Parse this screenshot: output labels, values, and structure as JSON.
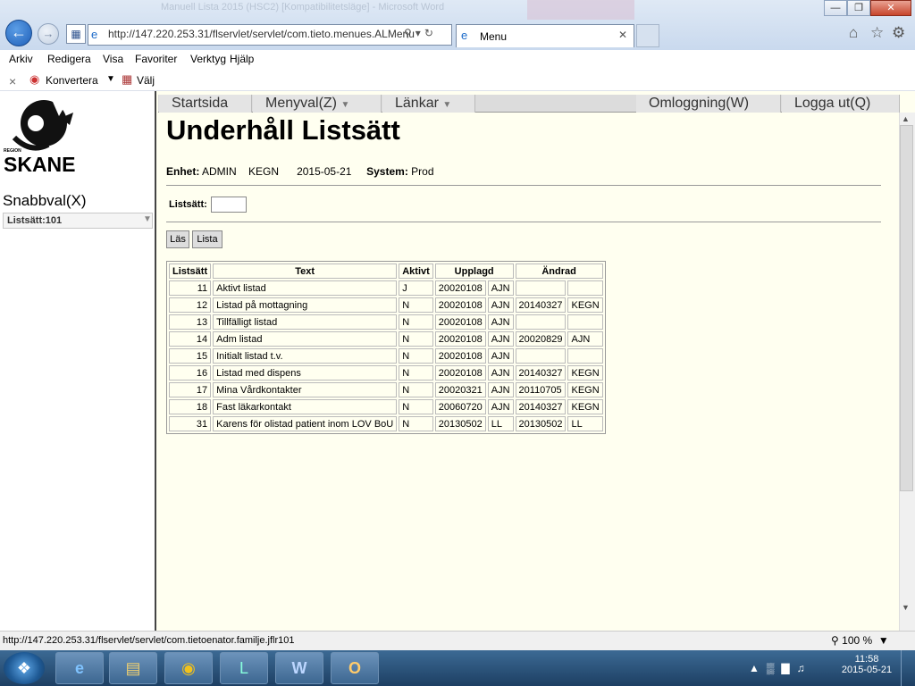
{
  "window": {
    "title": "Manuell Lista 2015 (HSC2) [Kompatibilitetsläge] - Microsoft Word",
    "controls": {
      "minimize": "—",
      "maximize": "❐",
      "close": "✕"
    }
  },
  "browser": {
    "address": "http://147.220.253.31/flservlet/servlet/com.tieto.menues.ALMenu",
    "tab_title": "Menu",
    "menu": [
      "Arkiv",
      "Redigera",
      "Visa",
      "Favoriter",
      "Verktyg",
      "Hjälp"
    ],
    "cmd": {
      "close_x": "×",
      "konvertera": "Konvertera",
      "valj": "Välj"
    },
    "status_url": "http://147.220.253.31/flservlet/servlet/com.tietoenator.familje.jflr101",
    "zoom": "100 %"
  },
  "left": {
    "logo_region": "REGION",
    "logo_name": "SKANE",
    "snabbval": "Snabbval(X)",
    "snabbval_selected": "Listsätt:101"
  },
  "topnav": {
    "start": "Startsida",
    "menyval": "Menyval(Z)",
    "lankar": "Länkar",
    "omloggning": "Omloggning(W)",
    "logga_ut": "Logga ut(Q)"
  },
  "page": {
    "title": "Underhåll Listsätt",
    "enhet_label": "Enhet:",
    "enhet_value": "ADMIN",
    "user": "KEGN",
    "date": "2015-05-21",
    "system_label": "System:",
    "system_value": "Prod",
    "listsatt_label": "Listsätt:",
    "listsatt_value": "",
    "btn_las": "Läs",
    "btn_lista": "Lista"
  },
  "table": {
    "headers": [
      "Listsätt",
      "Text",
      "Aktivt",
      "Upplagd",
      "Ändrad"
    ],
    "rows": [
      {
        "id": "11",
        "text": "Aktivt listad",
        "aktivt": "J",
        "upp_date": "20020108",
        "upp_user": "AJN",
        "and_date": "",
        "and_user": ""
      },
      {
        "id": "12",
        "text": "Listad på mottagning",
        "aktivt": "N",
        "upp_date": "20020108",
        "upp_user": "AJN",
        "and_date": "20140327",
        "and_user": "KEGN"
      },
      {
        "id": "13",
        "text": "Tillfälligt listad",
        "aktivt": "N",
        "upp_date": "20020108",
        "upp_user": "AJN",
        "and_date": "",
        "and_user": ""
      },
      {
        "id": "14",
        "text": "Adm listad",
        "aktivt": "N",
        "upp_date": "20020108",
        "upp_user": "AJN",
        "and_date": "20020829",
        "and_user": "AJN"
      },
      {
        "id": "15",
        "text": "Initialt listad t.v.",
        "aktivt": "N",
        "upp_date": "20020108",
        "upp_user": "AJN",
        "and_date": "",
        "and_user": ""
      },
      {
        "id": "16",
        "text": "Listad med dispens",
        "aktivt": "N",
        "upp_date": "20020108",
        "upp_user": "AJN",
        "and_date": "20140327",
        "and_user": "KEGN"
      },
      {
        "id": "17",
        "text": "Mina Vårdkontakter",
        "aktivt": "N",
        "upp_date": "20020321",
        "upp_user": "AJN",
        "and_date": "20110705",
        "and_user": "KEGN"
      },
      {
        "id": "18",
        "text": "Fast läkarkontakt",
        "aktivt": "N",
        "upp_date": "20060720",
        "upp_user": "AJN",
        "and_date": "20140327",
        "and_user": "KEGN"
      },
      {
        "id": "31",
        "text": "Karens för olistad patient inom LOV BoU",
        "aktivt": "N",
        "upp_date": "20130502",
        "upp_user": "LL",
        "and_date": "20130502",
        "and_user": "LL"
      }
    ]
  },
  "taskbar": {
    "time": "11:58",
    "date": "2015-05-21"
  },
  "colors": {
    "content_bg": "#fffff0",
    "nav_bg": "#dcdcdc",
    "taskbar": "#2a5077"
  }
}
